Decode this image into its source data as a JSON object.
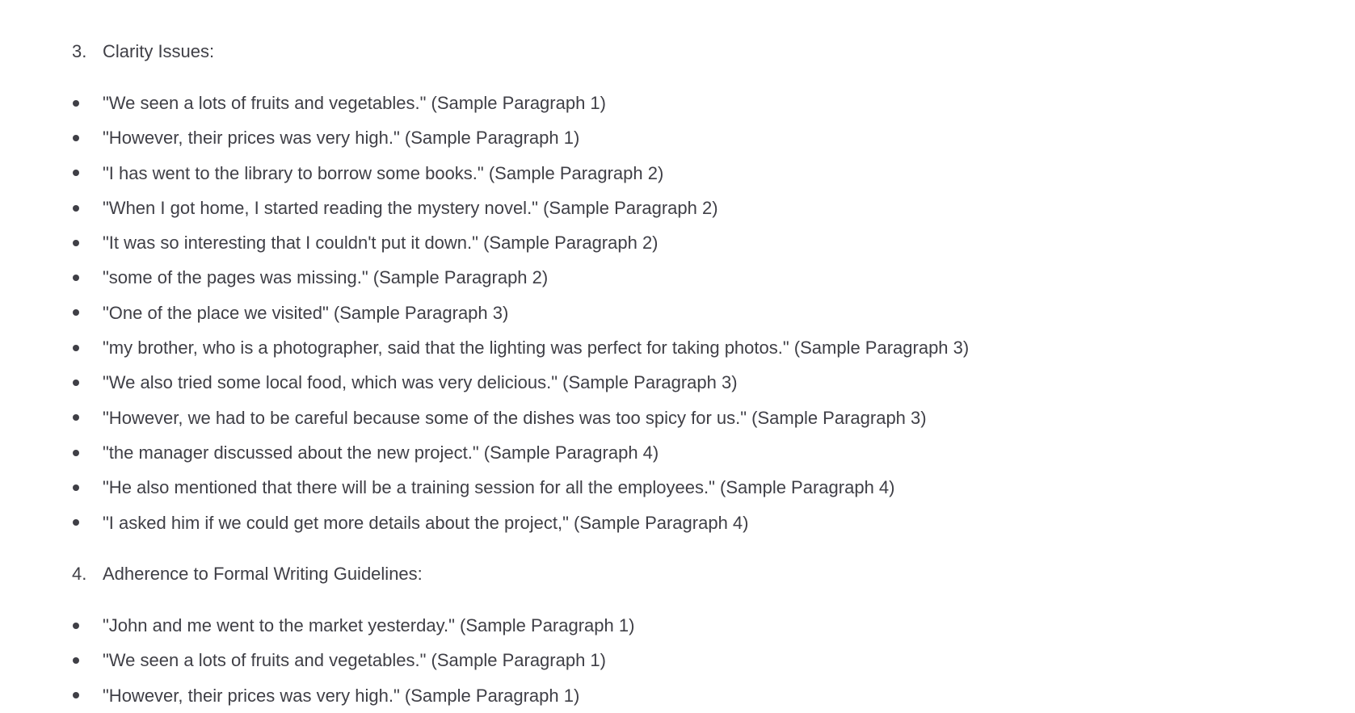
{
  "section3": {
    "number": "3.",
    "title": "Clarity Issues:",
    "items": [
      "\"We seen a lots of fruits and vegetables.\" (Sample Paragraph 1)",
      "\"However, their prices was very high.\" (Sample Paragraph 1)",
      "\"I has went to the library to borrow some books.\" (Sample Paragraph 2)",
      "\"When I got home, I started reading the mystery novel.\" (Sample Paragraph 2)",
      "\"It was so interesting that I couldn't put it down.\" (Sample Paragraph 2)",
      "\"some of the pages was missing.\" (Sample Paragraph 2)",
      "\"One of the place we visited\" (Sample Paragraph 3)",
      "\"my brother, who is a photographer, said that the lighting was perfect for taking photos.\" (Sample Paragraph 3)",
      "\"We also tried some local food, which was very delicious.\" (Sample Paragraph 3)",
      "\"However, we had to be careful because some of the dishes was too spicy for us.\" (Sample Paragraph 3)",
      "\"the manager discussed about the new project.\" (Sample Paragraph 4)",
      "\"He also mentioned that there will be a training session for all the employees.\" (Sample Paragraph 4)",
      "\"I asked him if we could get more details about the project,\" (Sample Paragraph 4)"
    ]
  },
  "section4": {
    "number": "4.",
    "title": "Adherence to Formal Writing Guidelines:",
    "items": [
      "\"John and me went to the market yesterday.\" (Sample Paragraph 1)",
      "\"We seen a lots of fruits and vegetables.\" (Sample Paragraph 1)",
      "\"However, their prices was very high.\" (Sample Paragraph 1)"
    ]
  }
}
